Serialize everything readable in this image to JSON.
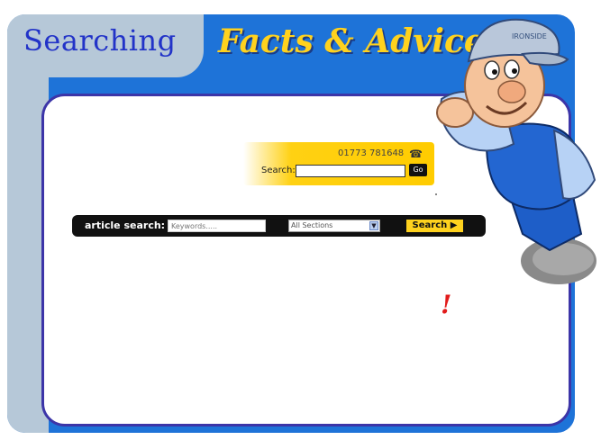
{
  "header": {
    "searching_title": "Searching",
    "facts_title": "Facts & Advice"
  },
  "quick_search": {
    "phone_number": "01773 781648",
    "phone_icon": "telephone-icon",
    "label": "Search:",
    "value": "",
    "go_label": "Go"
  },
  "article_search": {
    "label": "article search:",
    "keywords_placeholder": "Keywords.....",
    "sections_selected": "All Sections",
    "search_button": "Search ▶"
  },
  "decorations": {
    "exclamation": "!",
    "mascot": "plumber-mascot-image"
  },
  "colors": {
    "frame_blue": "#1e73d8",
    "tab_grey": "#b6c8d8",
    "title_blue": "#2233c8",
    "accent_yellow": "#ffd21e",
    "border_purple": "#3c35a8"
  }
}
